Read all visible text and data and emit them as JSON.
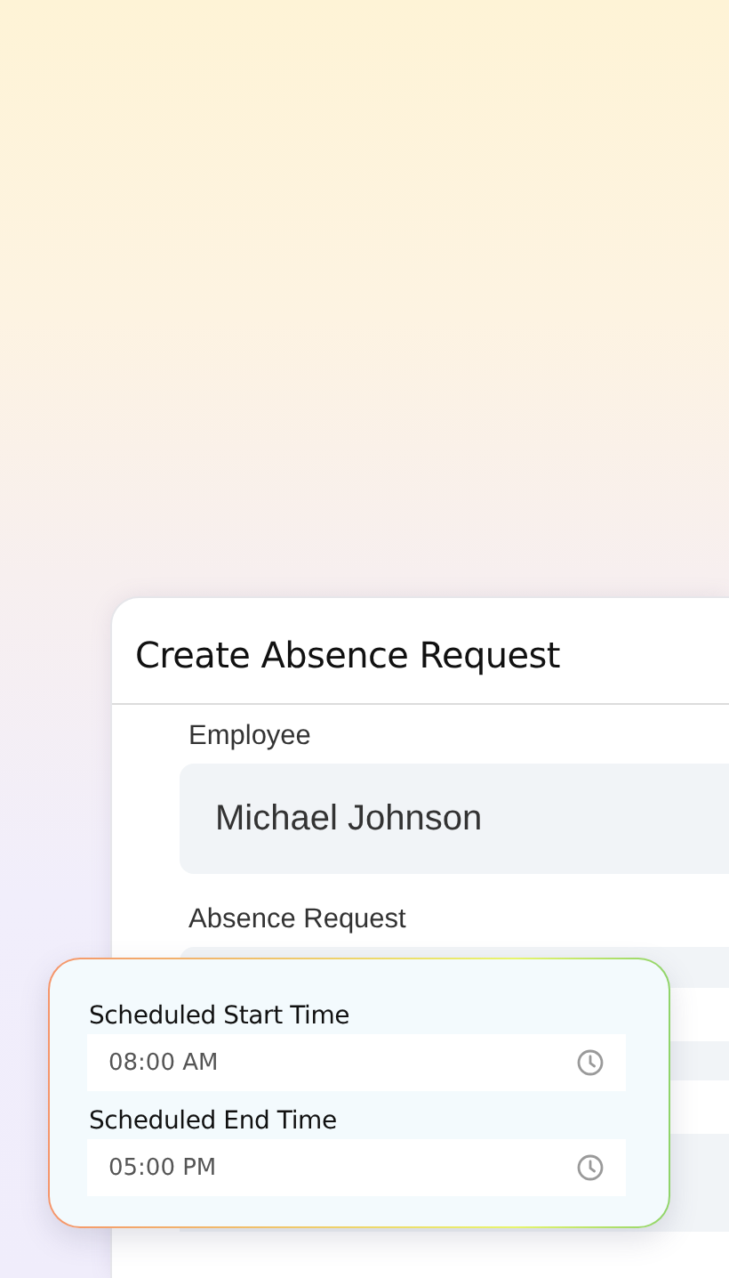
{
  "dialog": {
    "title": "Create Absence Request",
    "fields": [
      {
        "label": "Employee",
        "value": "Michael Johnson"
      },
      {
        "label": "Absence Request"
      }
    ]
  },
  "time_popup": {
    "fields": [
      {
        "label": "Scheduled Start Time",
        "value": "08:00 AM"
      },
      {
        "label": "Scheduled End Time",
        "value": "05:00 PM"
      }
    ]
  }
}
